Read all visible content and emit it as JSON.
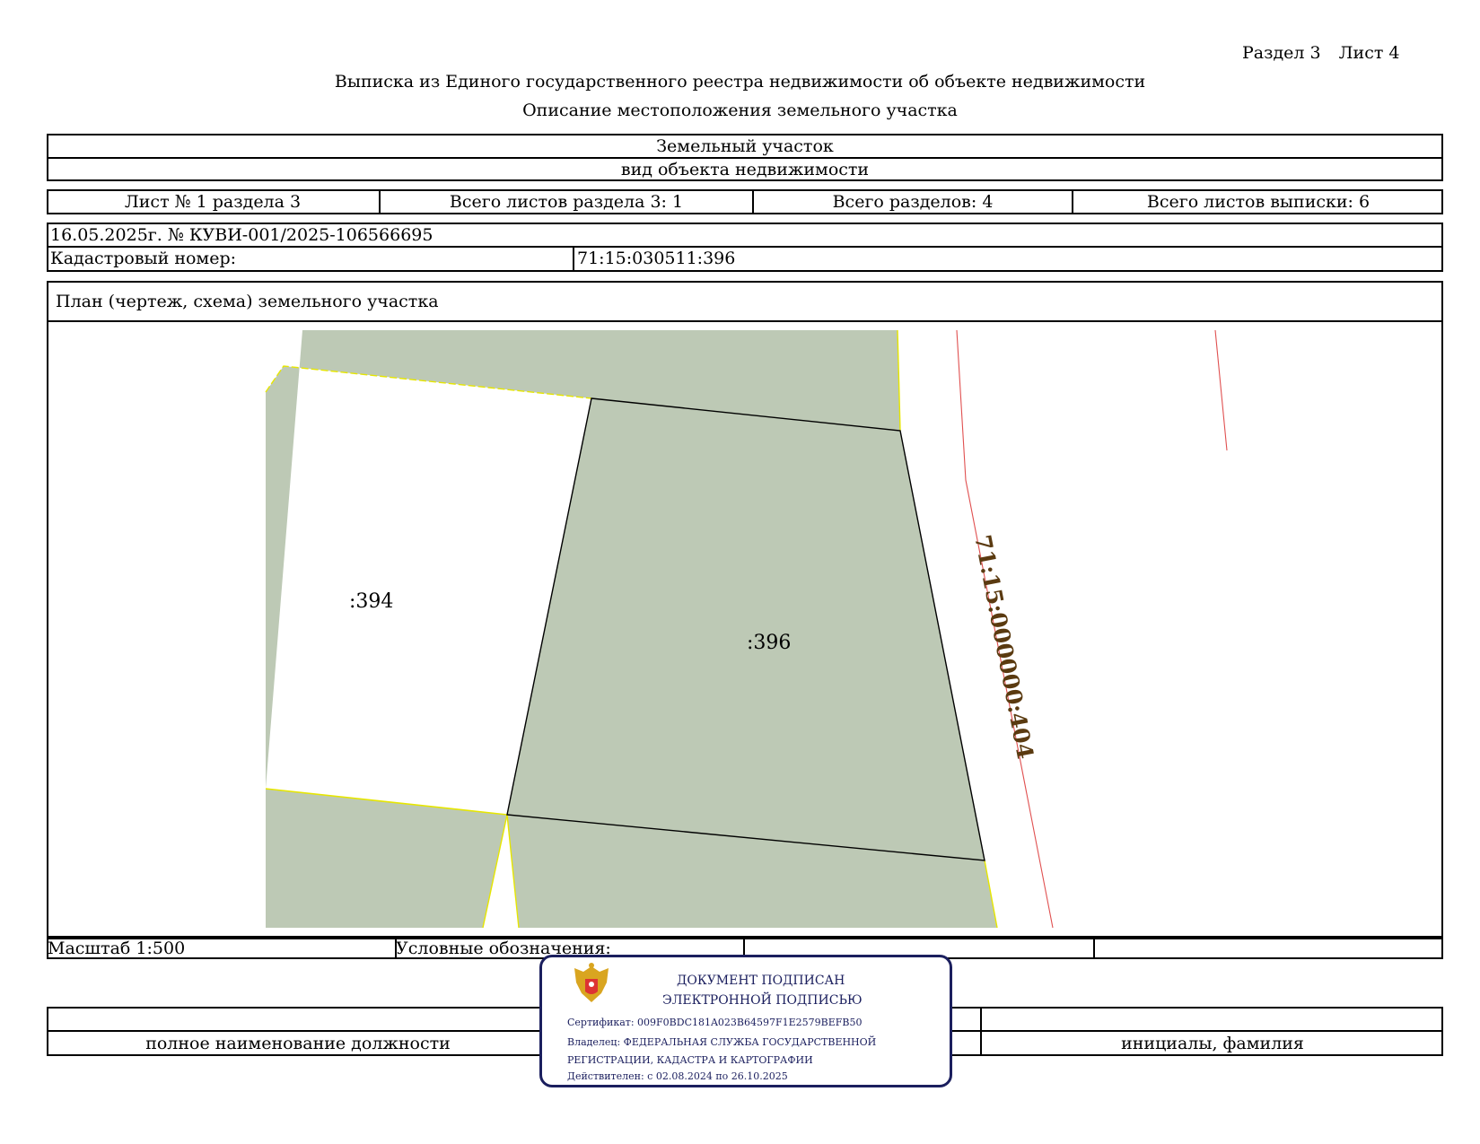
{
  "header": {
    "section": "Раздел 3",
    "sheet": "Лист 4",
    "title": "Выписка из Единого государственного реестра недвижимости об объекте недвижимости",
    "subtitle": "Описание местоположения земельного участка"
  },
  "object": {
    "type_value": "Земельный участок",
    "type_caption": "вид объекта недвижимости"
  },
  "sheets": {
    "sheet_no": "Лист № 1 раздела 3",
    "total_section_sheets": "Всего листов раздела 3: 1",
    "total_sections": "Всего разделов: 4",
    "total_extract_sheets": "Всего листов выписки: 6"
  },
  "record": {
    "date_number": "16.05.2025г. № КУВИ-001/2025-106566695",
    "cadastral_label": "Кадастровый номер:",
    "cadastral_value": "71:15:030511:396"
  },
  "plan": {
    "heading": "План (чертеж, схема) земельного участка",
    "parcels": [
      {
        "label": ":394"
      },
      {
        "label": ":396"
      }
    ],
    "road_label": "71:15:000000:404",
    "colors": {
      "parcel_fill": "#bdc9b5",
      "neighbor_boundary": "#e6e600",
      "subject_boundary": "#000000",
      "road_line": "#e05050",
      "road_label": "#5a3a10"
    }
  },
  "footer": {
    "scale": "Масштаб 1:500",
    "legend": "Условные обозначения:",
    "position_caption": "полное наименование должности",
    "name_caption": "инициалы, фамилия"
  },
  "stamp": {
    "line1": "ДОКУМЕНТ ПОДПИСАН",
    "line2": "ЭЛЕКТРОННОЙ ПОДПИСЬЮ",
    "certificate": "Сертификат: 009F0BDC181A023B64597F1E2579BEFB50",
    "owner1": "Владелец: ФЕДЕРАЛЬНАЯ СЛУЖБА ГОСУДАРСТВЕННОЙ",
    "owner2": "РЕГИСТРАЦИИ, КАДАСТРА И КАРТОГРАФИИ",
    "valid": "Действителен: с 02.08.2024 по 26.10.2025",
    "emblem_icon": "coat-of-arms-icon",
    "color": "#1b1f5e"
  }
}
